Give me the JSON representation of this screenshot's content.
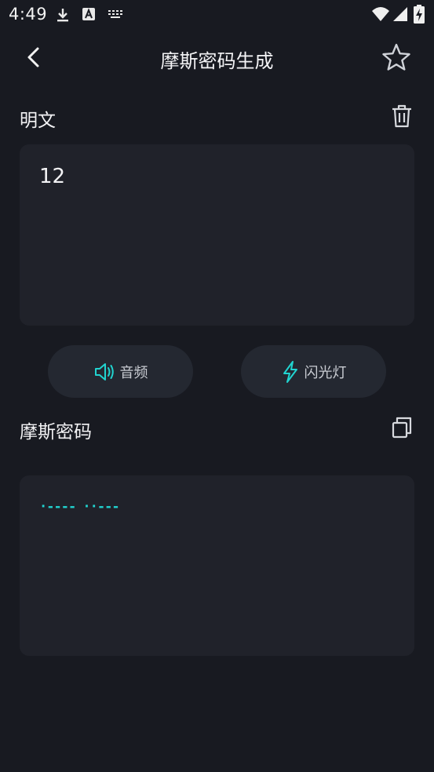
{
  "status_bar": {
    "time": "4:49",
    "icons": [
      "download-icon",
      "a-icon",
      "keyboard-icon",
      "wifi-icon",
      "signal-icon",
      "battery-charging-icon"
    ]
  },
  "header": {
    "title": "摩斯密码生成",
    "back_icon": "chevron-left-icon",
    "favorite_icon": "star-outline-icon"
  },
  "plain_section": {
    "label": "明文",
    "clear_icon": "trash-icon",
    "input_value": "12"
  },
  "actions": {
    "audio_label": "音频",
    "audio_icon": "speaker-icon",
    "flash_label": "闪光灯",
    "flash_icon": "lightning-icon"
  },
  "morse_section": {
    "label": "摩斯密码",
    "copy_icon": "copy-icon",
    "output_value": "·---- ··---"
  },
  "colors": {
    "background": "#181a21",
    "panel": "#20222a",
    "pill": "#242831",
    "accent": "#21d4d0",
    "text": "#f3f3f5"
  }
}
